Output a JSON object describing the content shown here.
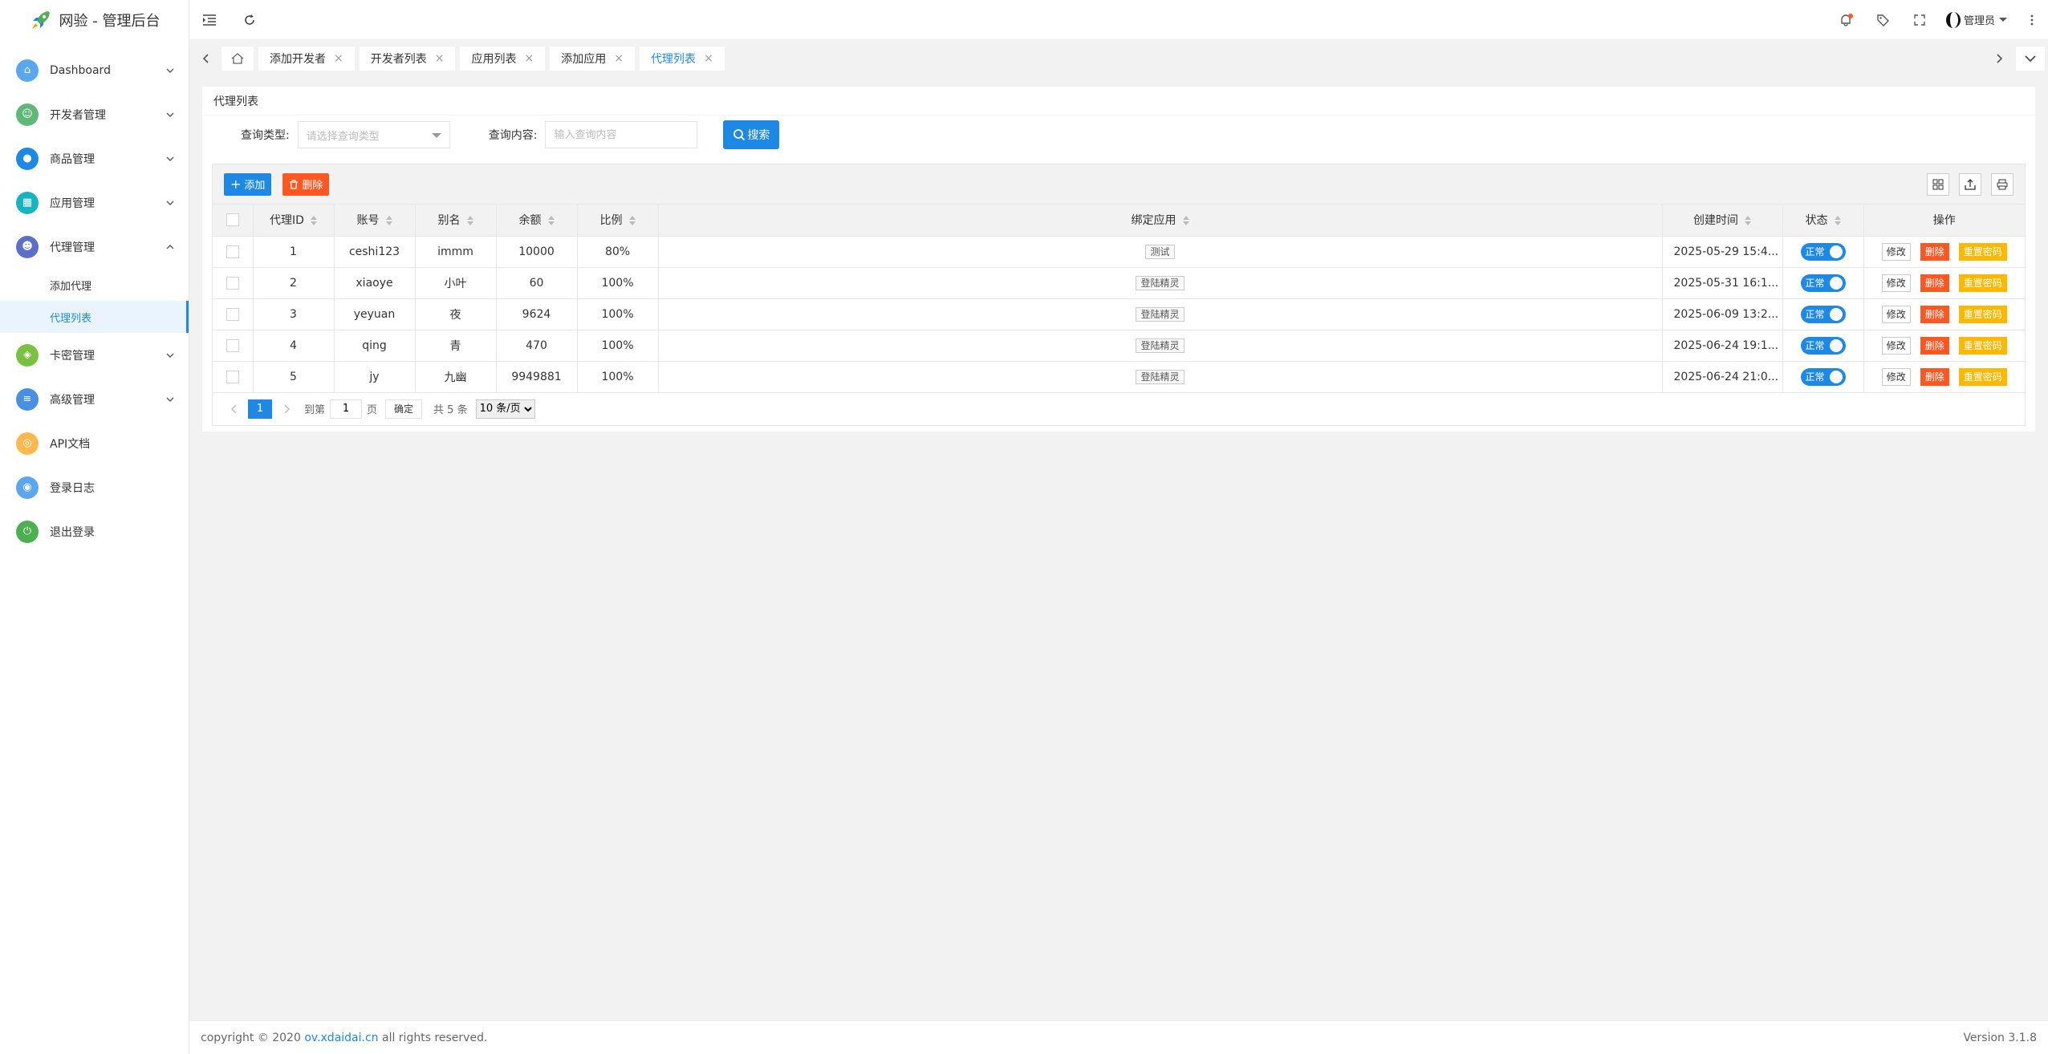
{
  "app": {
    "title": "网验 - 管理后台"
  },
  "sidebar": {
    "items": [
      {
        "label": "Dashboard",
        "icon": "home-icon",
        "color": "#5aa7f0",
        "glyph": "⌂"
      },
      {
        "label": "开发者管理",
        "icon": "user-icon",
        "color": "#5fb878",
        "glyph": "☺"
      },
      {
        "label": "商品管理",
        "icon": "apple-icon",
        "color": "#1e88e5",
        "glyph": "●"
      },
      {
        "label": "应用管理",
        "icon": "app-icon",
        "color": "#17b3c1",
        "glyph": "▦"
      },
      {
        "label": "代理管理",
        "icon": "group-icon",
        "color": "#5b6fc9",
        "glyph": "☻"
      }
    ],
    "sub_items": [
      {
        "label": "添加代理"
      },
      {
        "label": "代理列表"
      }
    ],
    "items_after": [
      {
        "label": "卡密管理",
        "icon": "box-icon",
        "color": "#7ac142",
        "glyph": "◈"
      },
      {
        "label": "高级管理",
        "icon": "sliders-icon",
        "color": "#4a90e2",
        "glyph": "≡"
      },
      {
        "label": "API文档",
        "icon": "doc-icon",
        "color": "#ffb84d",
        "glyph": "◎"
      },
      {
        "label": "登录日志",
        "icon": "log-icon",
        "color": "#5aa7f0",
        "glyph": "◉"
      },
      {
        "label": "退出登录",
        "icon": "power-icon",
        "color": "#4caf50",
        "glyph": "⏻"
      }
    ]
  },
  "header": {
    "user_name": "管理员"
  },
  "tabs": [
    {
      "label": "添加开发者"
    },
    {
      "label": "开发者列表"
    },
    {
      "label": "应用列表"
    },
    {
      "label": "添加应用"
    },
    {
      "label": "代理列表"
    }
  ],
  "page": {
    "title": "代理列表",
    "search": {
      "type_label": "查询类型:",
      "type_placeholder": "请选择查询类型",
      "content_label": "查询内容:",
      "content_placeholder": "输入查询内容",
      "button": "搜索"
    },
    "toolbar": {
      "add": "添加",
      "delete": "删除"
    }
  },
  "table": {
    "headers": [
      "代理ID",
      "账号",
      "别名",
      "余额",
      "比例",
      "绑定应用",
      "创建时间",
      "状态",
      "操作"
    ],
    "rows": [
      {
        "id": "1",
        "account": "ceshi123",
        "alias": "immm",
        "balance": "10000",
        "ratio": "80%",
        "app": "测试",
        "created": "2025-05-29 15:4...",
        "status": "正常"
      },
      {
        "id": "2",
        "account": "xiaoye",
        "alias": "小叶",
        "balance": "60",
        "ratio": "100%",
        "app": "登陆精灵",
        "created": "2025-05-31 16:1...",
        "status": "正常"
      },
      {
        "id": "3",
        "account": "yeyuan",
        "alias": "夜",
        "balance": "9624",
        "ratio": "100%",
        "app": "登陆精灵",
        "created": "2025-06-09 13:2...",
        "status": "正常"
      },
      {
        "id": "4",
        "account": "qing",
        "alias": "青",
        "balance": "470",
        "ratio": "100%",
        "app": "登陆精灵",
        "created": "2025-06-24 19:1...",
        "status": "正常"
      },
      {
        "id": "5",
        "account": "jy",
        "alias": "九幽",
        "balance": "9949881",
        "ratio": "100%",
        "app": "登陆精灵",
        "created": "2025-06-24 21:0...",
        "status": "正常"
      }
    ],
    "ops": {
      "edit": "修改",
      "delete": "删除",
      "reset": "重置密码"
    }
  },
  "pager": {
    "current": "1",
    "goto_label": "到第",
    "goto_value": "1",
    "page_unit": "页",
    "ok": "确定",
    "total": "共 5 条",
    "size_option": "10 条/页"
  },
  "footer": {
    "copyright_prefix": "copyright © 2020 ",
    "link": "ov.xdaidai.cn",
    "copyright_suffix": " all rights reserved.",
    "version": "Version 3.1.8"
  }
}
